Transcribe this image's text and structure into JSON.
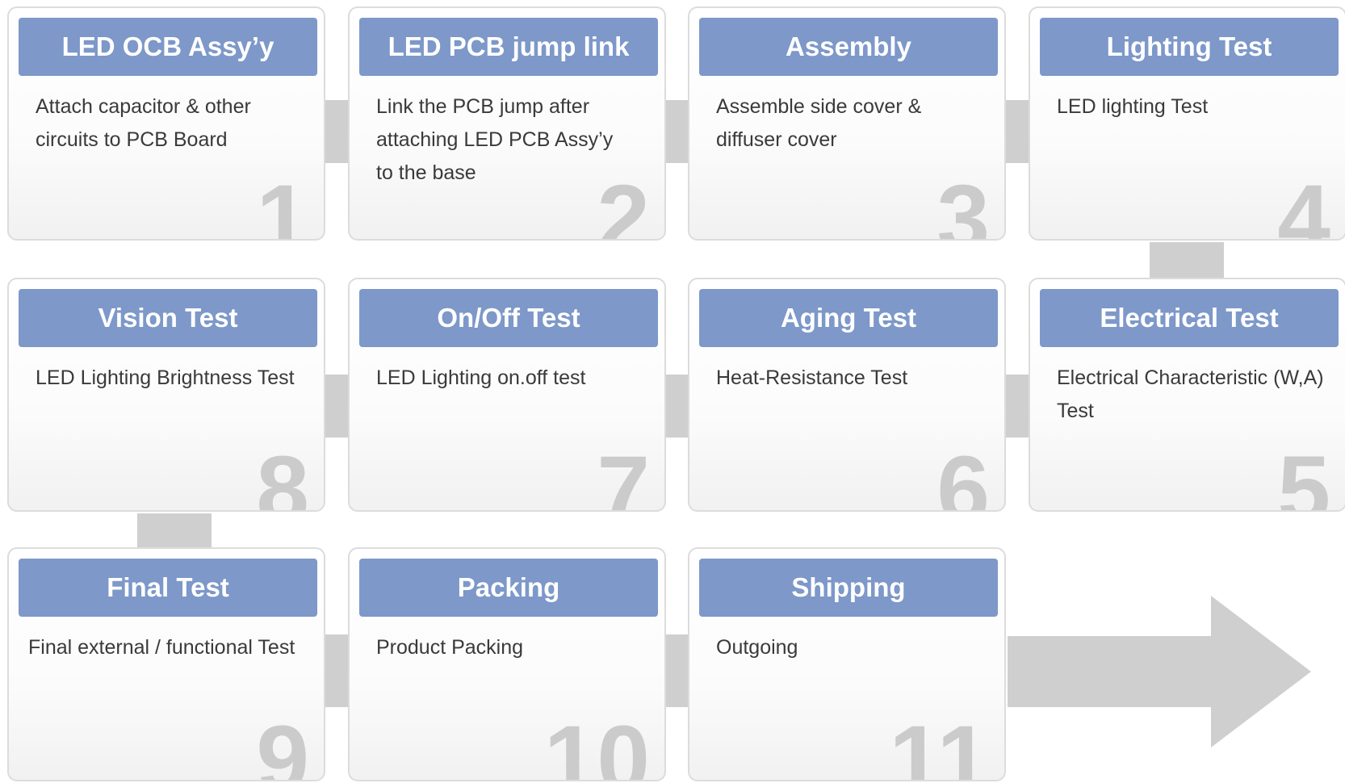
{
  "steps": [
    {
      "number": "1",
      "title": "LED OCB Assy’y",
      "lines": [
        "Attach capacitor & other",
        "circuits to PCB Board"
      ]
    },
    {
      "number": "2",
      "title": "LED PCB jump link",
      "lines": [
        "Link the PCB jump after",
        "attaching LED PCB Assy’y",
        "to the base"
      ]
    },
    {
      "number": "3",
      "title": "Assembly",
      "lines": [
        "Assemble side cover &",
        "diffuser cover"
      ]
    },
    {
      "number": "4",
      "title": "Lighting Test",
      "lines": [
        "LED lighting Test"
      ]
    },
    {
      "number": "5",
      "title": "Electrical Test",
      "lines": [
        "Electrical Characteristic (W,A)",
        "Test"
      ]
    },
    {
      "number": "6",
      "title": "Aging Test",
      "lines": [
        "Heat-Resistance Test"
      ]
    },
    {
      "number": "7",
      "title": "On/Off Test",
      "lines": [
        "LED Lighting on.off test"
      ]
    },
    {
      "number": "8",
      "title": "Vision Test",
      "lines": [
        "LED Lighting Brightness Test"
      ]
    },
    {
      "number": "9",
      "title": "Final Test",
      "lines": [
        "Final external / functional Test"
      ]
    },
    {
      "number": "10",
      "title": "Packing",
      "lines": [
        "Product Packing"
      ]
    },
    {
      "number": "11",
      "title": "Shipping",
      "lines": [
        "Outgoing"
      ]
    }
  ],
  "colors": {
    "title_bg": "#7d98c9",
    "connector": "#cfcfcf",
    "number": "#cbcbcb"
  }
}
